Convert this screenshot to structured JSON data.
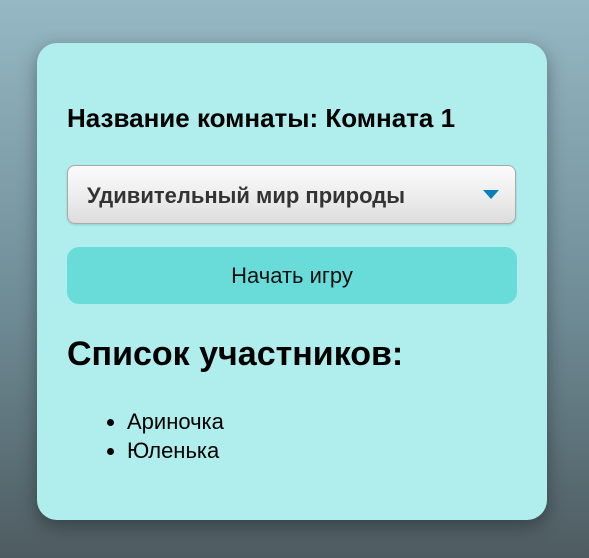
{
  "room": {
    "label": "Название комнаты:",
    "name": "Комната 1",
    "title": "Название комнаты: Комната 1"
  },
  "topic_select": {
    "selected": "Удивительный мир природы",
    "icon": "chevron-down-icon"
  },
  "start_button": {
    "label": "Начать игру"
  },
  "participants": {
    "heading": "Список участников:",
    "items": [
      "Ариночка",
      "Юленька"
    ]
  },
  "colors": {
    "card_background": "#b0eeee",
    "button_background": "#69dcd9",
    "chevron": "#0a7fb8"
  }
}
